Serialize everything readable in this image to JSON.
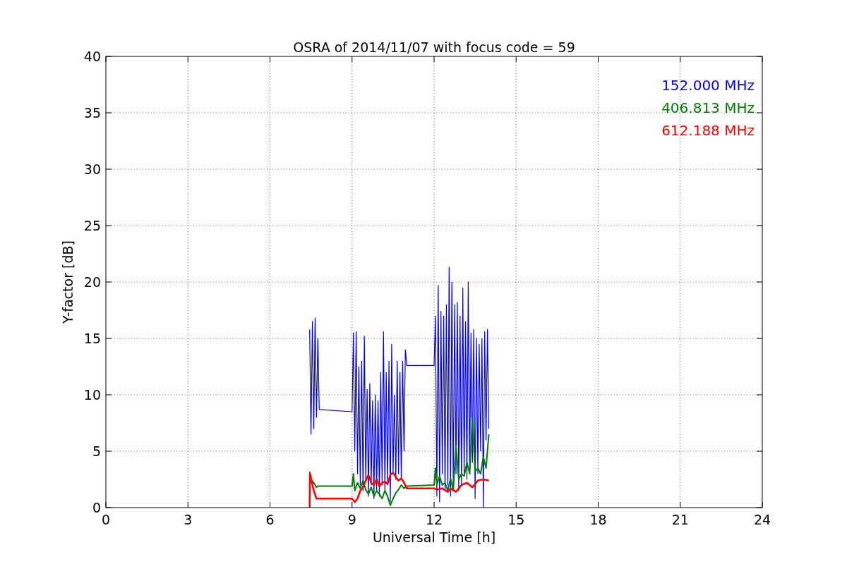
{
  "chart_data": {
    "type": "line",
    "title": "OSRA of 2014/11/07 with focus code = 59",
    "xlabel": "Universal Time [h]",
    "ylabel": "Y-factor [dB]",
    "grid": true,
    "xlim": [
      0,
      24
    ],
    "ylim": [
      0,
      40
    ],
    "xticks": [
      0,
      3,
      6,
      9,
      12,
      15,
      18,
      21,
      24
    ],
    "yticks": [
      0,
      5,
      10,
      15,
      20,
      25,
      30,
      35,
      40
    ],
    "series": [
      {
        "name": "152.000 MHz",
        "color": "#0000ff",
        "x": [
          7.45,
          7.5,
          7.55,
          7.6,
          7.65,
          7.7,
          7.75,
          7.8,
          9.0,
          9.05,
          9.1,
          9.15,
          9.2,
          9.25,
          9.3,
          9.35,
          9.4,
          9.45,
          9.5,
          9.55,
          9.6,
          9.65,
          9.7,
          9.75,
          9.8,
          9.85,
          9.9,
          9.95,
          10.0,
          10.05,
          10.1,
          10.15,
          10.2,
          10.25,
          10.3,
          10.35,
          10.4,
          10.45,
          10.5,
          10.55,
          10.6,
          10.65,
          10.7,
          10.75,
          10.8,
          10.85,
          10.9,
          10.95,
          11.0,
          12.0,
          12.05,
          12.1,
          12.15,
          12.2,
          12.25,
          12.3,
          12.35,
          12.4,
          12.45,
          12.5,
          12.55,
          12.6,
          12.65,
          12.7,
          12.75,
          12.8,
          12.85,
          12.9,
          12.95,
          13.0,
          13.05,
          13.1,
          13.15,
          13.2,
          13.25,
          13.3,
          13.35,
          13.4,
          13.45,
          13.5,
          13.55,
          13.6,
          13.65,
          13.7,
          13.75,
          13.8,
          13.85,
          13.9,
          13.95,
          14.0
        ],
        "values": [
          15.8,
          6.5,
          16.5,
          7,
          16.8,
          8,
          15,
          8.7,
          8.5,
          15.5,
          5,
          15.6,
          3,
          12.5,
          2,
          13,
          1.5,
          15.2,
          2.5,
          10.5,
          1,
          11,
          2,
          9.5,
          0.8,
          10,
          1.5,
          9.5,
          1,
          12,
          2,
          15.6,
          1.5,
          12,
          2,
          13,
          0.5,
          14.5,
          3,
          10,
          2.5,
          13,
          3,
          12,
          2.5,
          13,
          5,
          14,
          12.6,
          12.6,
          17,
          1,
          19.7,
          0.5,
          17.4,
          3,
          17,
          1.5,
          18,
          2,
          21.3,
          1,
          20,
          2,
          18,
          3,
          18.2,
          1.5,
          17,
          2,
          19.5,
          3,
          16.5,
          2.5,
          20,
          3,
          15.5,
          4,
          15.8,
          0.8,
          15,
          3,
          14.5,
          5,
          15,
          0,
          15.6,
          6,
          15.8,
          7
        ]
      },
      {
        "name": "406.813 MHz",
        "color": "#008000",
        "x": [
          7.45,
          7.5,
          7.6,
          7.7,
          7.75,
          9.0,
          9.05,
          9.1,
          9.2,
          9.3,
          9.4,
          9.5,
          9.6,
          9.7,
          9.8,
          9.9,
          10.0,
          10.1,
          10.2,
          10.3,
          10.4,
          10.5,
          10.6,
          10.7,
          10.8,
          10.9,
          11.0,
          12.0,
          12.05,
          12.1,
          12.2,
          12.3,
          12.4,
          12.5,
          12.6,
          12.7,
          12.8,
          12.9,
          13.0,
          13.1,
          13.2,
          13.3,
          13.4,
          13.5,
          13.6,
          13.7,
          13.8,
          13.9,
          14.0
        ],
        "values": [
          3.2,
          2.5,
          2.2,
          1.8,
          1.9,
          1.9,
          3,
          1.5,
          2.2,
          1.7,
          2.4,
          1.6,
          1.2,
          1.8,
          1.0,
          1.5,
          1.2,
          0.8,
          1.5,
          1.0,
          0.2,
          0.8,
          1.3,
          1.6,
          2,
          1.7,
          1.9,
          2,
          3.5,
          2,
          2.8,
          2,
          2.2,
          1.5,
          2.6,
          1.5,
          5.5,
          2.5,
          3,
          2.8,
          4,
          3,
          8,
          3.2,
          3.5,
          3,
          4.5,
          3.5,
          6.5
        ]
      },
      {
        "name": "612.188 MHz",
        "color": "#ff0000",
        "x": [
          7.45,
          7.46,
          7.6,
          7.7,
          9.0,
          9.1,
          9.2,
          9.3,
          9.4,
          9.5,
          9.6,
          9.7,
          9.8,
          9.9,
          10.0,
          10.1,
          10.2,
          10.3,
          10.4,
          10.5,
          10.6,
          10.7,
          10.8,
          10.9,
          11.0,
          12.0,
          12.1,
          12.3,
          12.5,
          12.6,
          12.8,
          13.0,
          13.2,
          13.4,
          13.6,
          13.8,
          14.0
        ],
        "values": [
          0,
          3,
          1.5,
          0.8,
          0.8,
          0.5,
          0.8,
          1.5,
          1.8,
          2.4,
          2.9,
          2.2,
          2,
          2.5,
          1.9,
          2.2,
          2.3,
          2.1,
          2.9,
          3.1,
          2.7,
          2.4,
          2.6,
          2.2,
          1.7,
          1.7,
          1.6,
          1.7,
          1.4,
          1.7,
          1.4,
          2.0,
          2.2,
          1.8,
          2.4,
          2.5,
          2.4
        ]
      }
    ]
  }
}
